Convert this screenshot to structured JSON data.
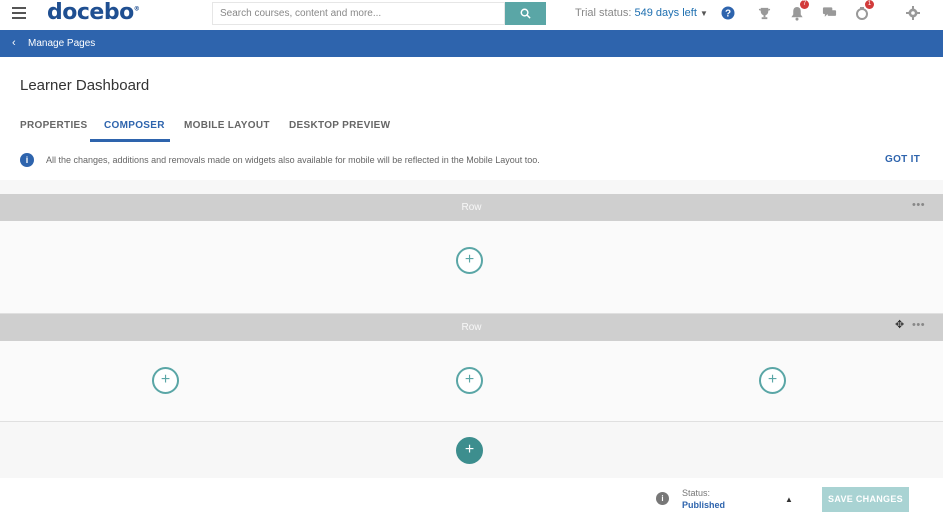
{
  "header": {
    "logo": "docebo",
    "search_placeholder": "Search courses, content and more...",
    "trial_label": "Trial status:",
    "trial_days": "549 days left",
    "notifications_badge": "7",
    "cart_badge": "1"
  },
  "subbar": {
    "back_label": "Manage Pages"
  },
  "page": {
    "title": "Learner Dashboard"
  },
  "tabs": [
    {
      "label": "PROPERTIES",
      "active": false
    },
    {
      "label": "COMPOSER",
      "active": true
    },
    {
      "label": "MOBILE LAYOUT",
      "active": false
    },
    {
      "label": "DESKTOP PREVIEW",
      "active": false
    }
  ],
  "info": {
    "message": "All the changes, additions and removals made on widgets also available for mobile will be reflected in the Mobile Layout too.",
    "dismiss_label": "GOT IT"
  },
  "rows": [
    {
      "label": "Row",
      "menu": "•••"
    },
    {
      "label": "Row",
      "menu": "•••"
    }
  ],
  "icons": {
    "plus": "+",
    "move": "✥"
  },
  "footer": {
    "status_label": "Status:",
    "status_value": "Published",
    "save_label": "SAVE CHANGES"
  },
  "colors": {
    "brand_blue": "#2e64ad",
    "teal": "#5aa6a6",
    "row_header": "#cfcfcf"
  }
}
